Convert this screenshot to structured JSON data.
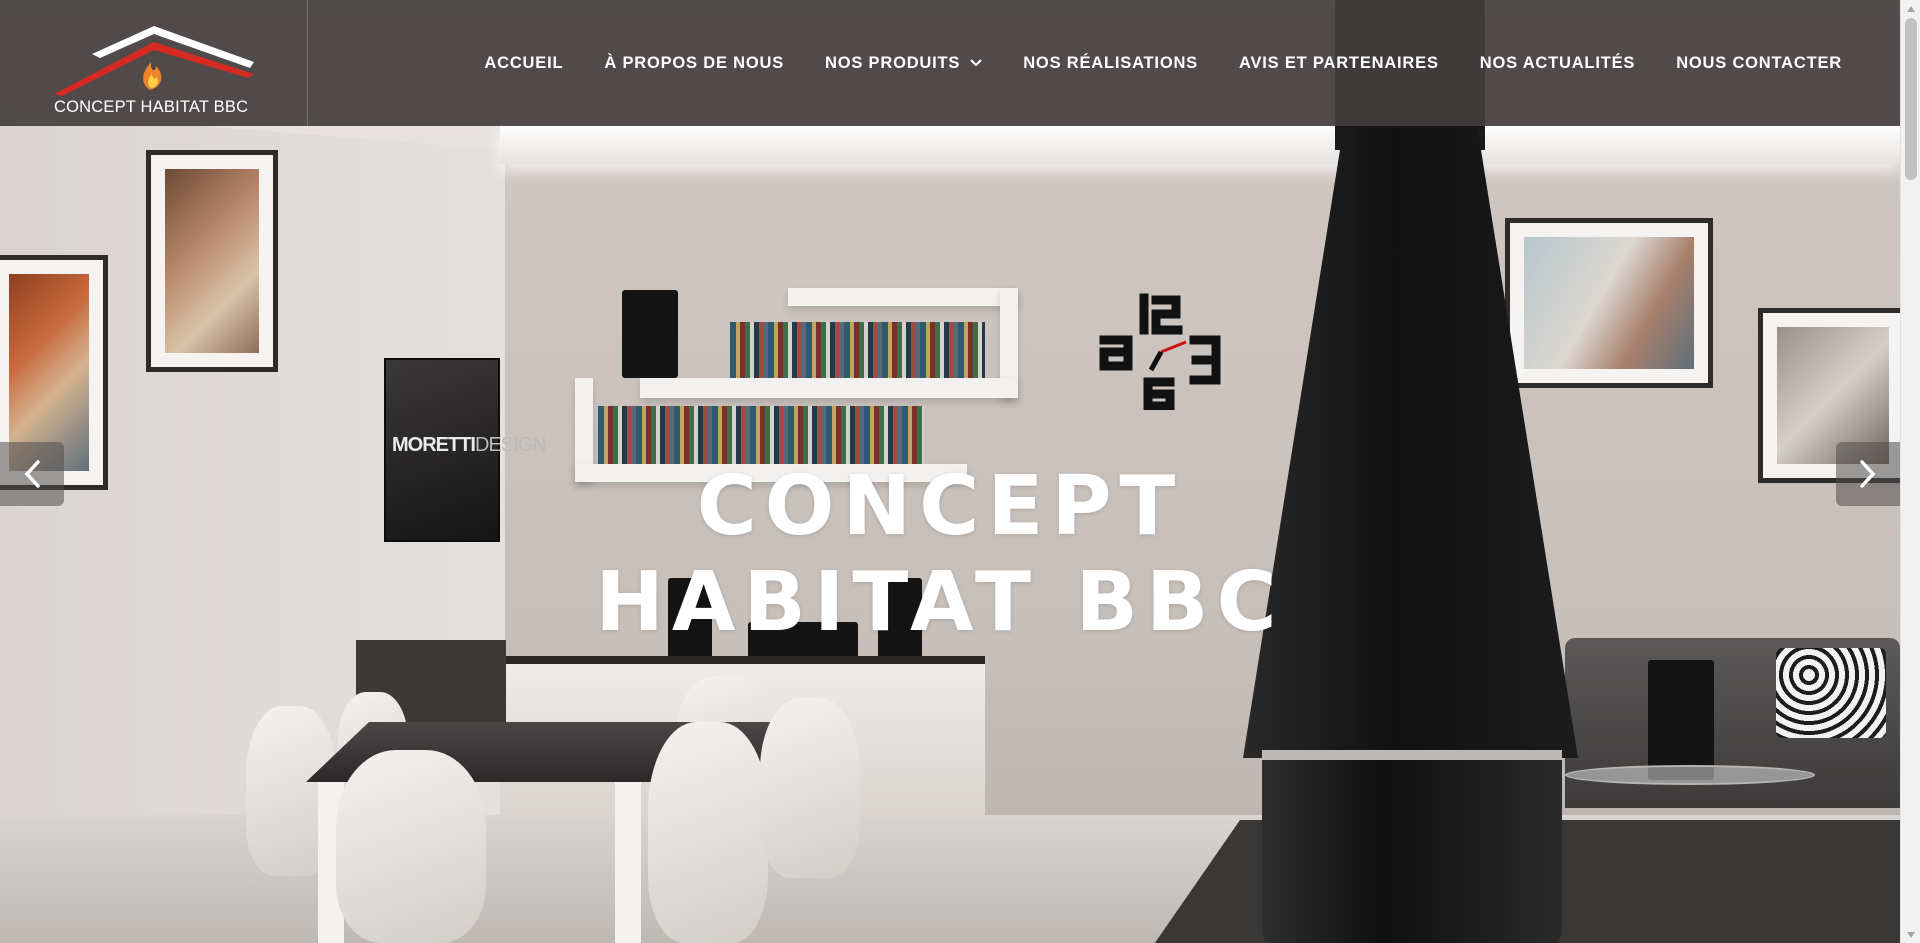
{
  "site": {
    "logo_text": "CONCEPT HABITAT BBC",
    "brand_colors": {
      "header_bg": "#423e3d",
      "roof_red": "#d42a22",
      "roof_white": "#ffffff",
      "flame": "#f0822a"
    }
  },
  "nav": {
    "items": [
      {
        "label": "ACCUEIL"
      },
      {
        "label": "À PROPOS DE NOUS"
      },
      {
        "label": "NOS PRODUITS",
        "has_dropdown": true,
        "icon": "chevron-down-icon"
      },
      {
        "label": "NOS RÉALISATIONS"
      },
      {
        "label": "AVIS ET PARTENAIRES"
      },
      {
        "label": "NOS ACTUALITÉS"
      },
      {
        "label": "NOUS CONTACTER"
      }
    ]
  },
  "hero": {
    "title_line1": "CONCEPT",
    "title_line2": "HABITAT BBC",
    "tv_brand_bold": "MORETTI",
    "tv_brand_light": "DESIGN",
    "prev_icon": "chevron-left-icon",
    "next_icon": "chevron-right-icon"
  }
}
